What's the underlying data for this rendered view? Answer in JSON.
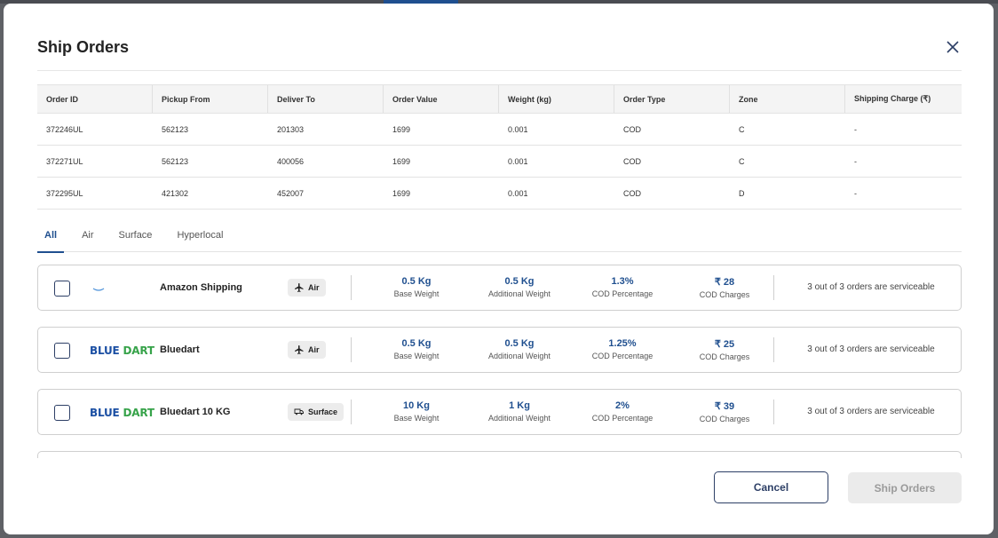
{
  "modal": {
    "title": "Ship Orders"
  },
  "orders_table": {
    "headers": [
      "Order ID",
      "Pickup From",
      "Deliver To",
      "Order Value",
      "Weight (kg)",
      "Order Type",
      "Zone",
      "Shipping Charge (₹)"
    ],
    "rows": [
      [
        "372246UL",
        "562123",
        "201303",
        "1699",
        "0.001",
        "COD",
        "C",
        "-"
      ],
      [
        "372271UL",
        "562123",
        "400056",
        "1699",
        "0.001",
        "COD",
        "C",
        "-"
      ],
      [
        "372295UL",
        "421302",
        "452007",
        "1699",
        "0.001",
        "COD",
        "D",
        "-"
      ]
    ]
  },
  "tabs": [
    {
      "label": "All",
      "active": true
    },
    {
      "label": "Air",
      "active": false
    },
    {
      "label": "Surface",
      "active": false
    },
    {
      "label": "Hyperlocal",
      "active": false
    }
  ],
  "couriers": [
    {
      "name": "Amazon Shipping",
      "logo": "amazon-smile",
      "mode": "Air",
      "mode_icon": "airplane-icon",
      "base_weight": "0.5 Kg",
      "additional_weight": "0.5 Kg",
      "cod_percentage": "1.3%",
      "cod_charges": "₹ 28",
      "serviceable": "3 out of 3 orders are serviceable"
    },
    {
      "name": "Bluedart",
      "logo_text": [
        "BLUE",
        "DART"
      ],
      "mode": "Air",
      "mode_icon": "airplane-icon",
      "base_weight": "0.5 Kg",
      "additional_weight": "0.5 Kg",
      "cod_percentage": "1.25%",
      "cod_charges": "₹ 25",
      "serviceable": "3 out of 3 orders are serviceable"
    },
    {
      "name": "Bluedart 10 KG",
      "logo_text": [
        "BLUE",
        "DART"
      ],
      "mode": "Surface",
      "mode_icon": "truck-icon",
      "base_weight": "10 Kg",
      "additional_weight": "1 Kg",
      "cod_percentage": "2%",
      "cod_charges": "₹ 39",
      "serviceable": "3 out of 3 orders are serviceable"
    }
  ],
  "metric_labels": {
    "base_weight": "Base Weight",
    "additional_weight": "Additional Weight",
    "cod_percentage": "COD Percentage",
    "cod_charges": "COD Charges"
  },
  "footer": {
    "cancel_label": "Cancel",
    "ship_label": "Ship Orders"
  },
  "colors": {
    "primary": "#1f4f8f",
    "border_dark": "#2d3f66",
    "bluedart_blue": "#1b4fa3",
    "bluedart_green": "#37a34a",
    "disabled_bg": "#ebebeb"
  }
}
